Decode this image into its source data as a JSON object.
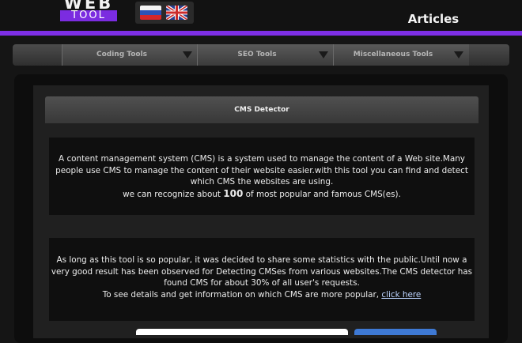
{
  "header": {
    "logo_top": "WEB",
    "logo_bottom": "TOOL",
    "title": "Articles",
    "languages": [
      {
        "name": "Russian",
        "icon": "russia-flag-icon"
      },
      {
        "name": "English",
        "icon": "uk-flag-icon"
      }
    ]
  },
  "nav": {
    "items": [
      {
        "label": "Coding Tools"
      },
      {
        "label": "SEO Tools"
      },
      {
        "label": "Miscellaneous Tools"
      }
    ]
  },
  "panel": {
    "title": "CMS Detector",
    "intro": {
      "line1": "A content management system (CMS) is a system used to manage the content of a Web site.Many people use CMS to manage the content of their website easier.with this tool you can find and detect which CMS the websites are using.",
      "line2_pre": "we can recognize about ",
      "line2_num": "100",
      "line2_post": " of most popular and famous CMS(es)."
    },
    "stats": {
      "text": "As long as this tool is so popular, it was decided to share some statistics with the public.Until now a very good result has been observed for Detecting CMSes from various websites.The CMS detector has found CMS for about 30% of all user's requests.",
      "details_pre": "To see details and get information on which CMS are more popular, ",
      "link": "click here"
    }
  },
  "colors": {
    "accent": "#7e2fe6",
    "background": "#151515",
    "link": "#bcd4ff"
  }
}
